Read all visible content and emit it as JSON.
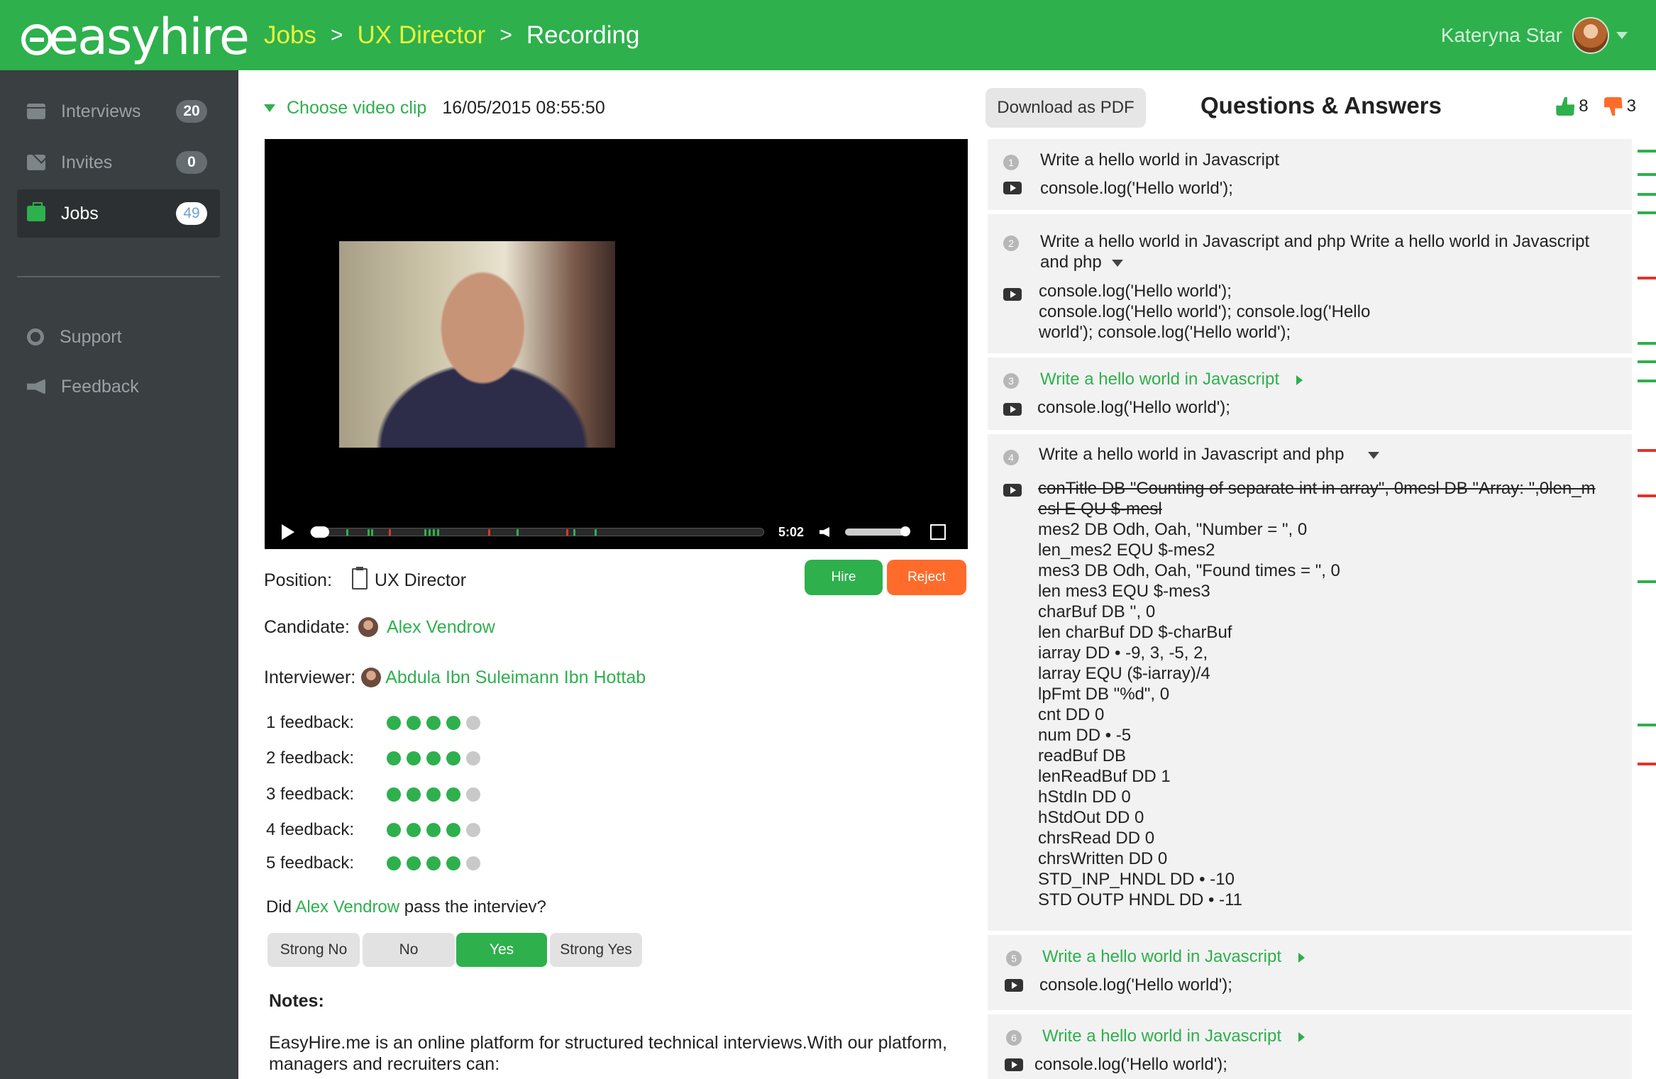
{
  "header": {
    "logo": "easyhire",
    "breadcrumb": [
      "Jobs",
      "UX Director",
      "Recording"
    ],
    "separator": ">",
    "user_name": "Kateryna Star"
  },
  "sidebar": {
    "items": [
      {
        "label": "Interviews",
        "count": "20",
        "icon": "calendar-icon"
      },
      {
        "label": "Invites",
        "count": "0",
        "icon": "mail-icon"
      },
      {
        "label": "Jobs",
        "count": "49",
        "icon": "briefcase-icon",
        "active": true
      },
      {
        "label": "Support",
        "icon": "lifebuoy-icon"
      },
      {
        "label": "Feedback",
        "icon": "megaphone-icon"
      }
    ]
  },
  "clip": {
    "choose_label": "Choose video clip",
    "datetime": "16/05/2015  08:55:50"
  },
  "player": {
    "time": "5:02",
    "progress": 0.0,
    "volume": 1.0,
    "marker_colors": [
      "#2eb04d",
      "#e0352b"
    ]
  },
  "actions": {
    "hire": "Hire",
    "reject": "Reject"
  },
  "info": {
    "position_label": "Position:",
    "position_value": "UX Director",
    "candidate_label": "Candidate:",
    "candidate_value": "Alex Vendrow",
    "interviewer_label": "Interviewer:",
    "interviewer_value": "Abdula Ibn Suleimann Ibn Hottab"
  },
  "feedback": [
    {
      "label": "1 feedback:",
      "score": 4,
      "max": 5
    },
    {
      "label": "2 feedback:",
      "score": 4,
      "max": 5
    },
    {
      "label": "3 feedback:",
      "score": 4,
      "max": 5
    },
    {
      "label": "4 feedback:",
      "score": 4,
      "max": 5
    },
    {
      "label": "5 feedback:",
      "score": 4,
      "max": 5
    }
  ],
  "pass": {
    "prefix": "Did",
    "name": "Alex Vendrow",
    "suffix": "pass the interviev?",
    "options": [
      "Strong No",
      "No",
      "Yes",
      "Strong Yes"
    ],
    "selected": "Yes"
  },
  "notes": {
    "title": "Notes:",
    "body": "EasyHire.me is an online platform for structured technical interviews.With our platform, managers and recruiters can:"
  },
  "qa": {
    "pdf_label": "Download as PDF",
    "title": "Questions & Answers",
    "thumbs_up": "8",
    "thumbs_down": "3",
    "items": [
      {
        "num": "1",
        "q": "Write a hello world in Javascript",
        "a": "console.log('Hello world');"
      },
      {
        "num": "2",
        "q": "Write a hello world in Javascript and php Write a hello world in Javascript and php",
        "a": "console.log('Hello world');\nconsole.log('Hello world'); console.log('Hello\nworld'); console.log('Hello world');"
      },
      {
        "num": "3",
        "q": "Write a hello world in Javascript",
        "a": "console.log('Hello world');"
      },
      {
        "num": "4",
        "q": "Write a hello world in Javascript and php",
        "a_strike": "conTitle DB \"Counting of separate int in array\", 0mesl DB \"Array: \",0len_m\nesl E QU $-mesl",
        "a": "mes2 DB Odh, Oah, \"Number = \", 0\nlen_mes2 EQU $-mes2\nmes3 DB Odh, Oah, \"Found times = \", 0\nlen mes3 EQU $-mes3\ncharBuf DB '', 0\nlen charBuf DD $-charBuf\niarray DD • -9, 3, -5, 2,\nlarray EQU ($-iarray)/4\nlpFmt DB \"%d\", 0\ncnt DD 0\nnum DD • -5\nreadBuf DB\nlenReadBuf DD 1\nhStdIn DD 0\nhStdOut DD 0\nchrsRead DD 0\nchrsWritten DD 0\nSTD_INP_HNDL DD • -10\nSTD OUTP HNDL DD • -11"
      },
      {
        "num": "5",
        "q": "Write a hello world in Javascript",
        "a": "console.log('Hello world');"
      },
      {
        "num": "6",
        "q": "Write a hello world in Javascript",
        "a": "console.log('Hello world');"
      }
    ]
  },
  "colors": {
    "brand_green": "#2eb04d",
    "reject_orange": "#ff6b2b",
    "crumb_yellow": "#e9f53a",
    "sidebar_bg": "#3a3f41"
  }
}
